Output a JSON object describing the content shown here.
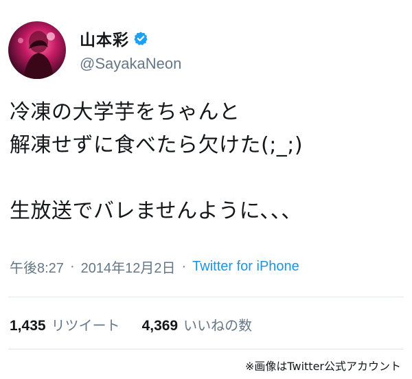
{
  "user": {
    "display_name": "山本彩",
    "handle": "@SayakaNeon",
    "verified": true,
    "avatar_icon": "profile-photo"
  },
  "tweet": {
    "text": "冷凍の大学芋をちゃんと\n解凍せずに食べたら欠けた(;_;)\n\n生放送でバレませんように、、、",
    "time": "午後8:27",
    "date": "2014年12月2日",
    "separator": "·",
    "source": "Twitter for iPhone"
  },
  "stats": {
    "retweets_count": "1,435",
    "retweets_label": "リツイート",
    "likes_count": "4,369",
    "likes_label": "いいねの数"
  },
  "credit": "※画像はTwitter公式アカウント",
  "colors": {
    "text": "#14171a",
    "secondary": "#657786",
    "link": "#1b95e0",
    "verified_badge": "#1da1f2",
    "divider": "#e1e8ed"
  }
}
